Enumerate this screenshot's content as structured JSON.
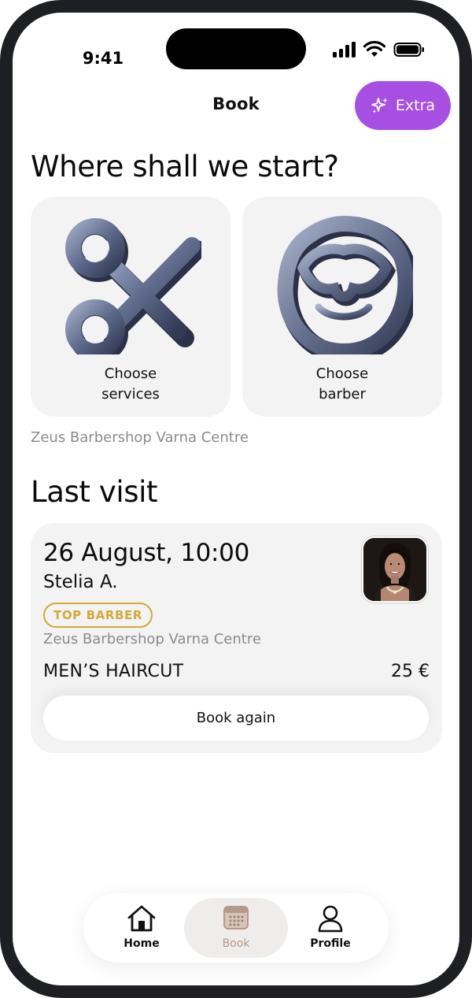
{
  "status_bar": {
    "time": "9:41"
  },
  "header": {
    "title": "Book",
    "extra_label": "Extra"
  },
  "start": {
    "heading": "Where shall we start?",
    "cards": [
      {
        "label_line1": "Choose",
        "label_line2": "services",
        "icon": "scissors-icon"
      },
      {
        "label_line1": "Choose",
        "label_line2": "barber",
        "icon": "beard-icon"
      }
    ],
    "shop": "Zeus Barbershop Varna Centre"
  },
  "last_visit": {
    "heading": "Last visit",
    "date": "26 August, 10:00",
    "barber": "Stelia A.",
    "badge": "TOP BARBER",
    "shop": "Zeus Barbershop Varna Centre",
    "service": "MEN’S HAIRCUT",
    "price": "25 €",
    "button": "Book again"
  },
  "nav": {
    "items": [
      {
        "label": "Home",
        "icon": "home-icon"
      },
      {
        "label": "Book",
        "icon": "calendar-icon",
        "active": true
      },
      {
        "label": "Profile",
        "icon": "user-icon"
      }
    ]
  },
  "colors": {
    "accent": "#a84fe3",
    "badge": "#d4a935",
    "card_bg": "#f3f3f3",
    "active_nav": "#b5998a"
  }
}
